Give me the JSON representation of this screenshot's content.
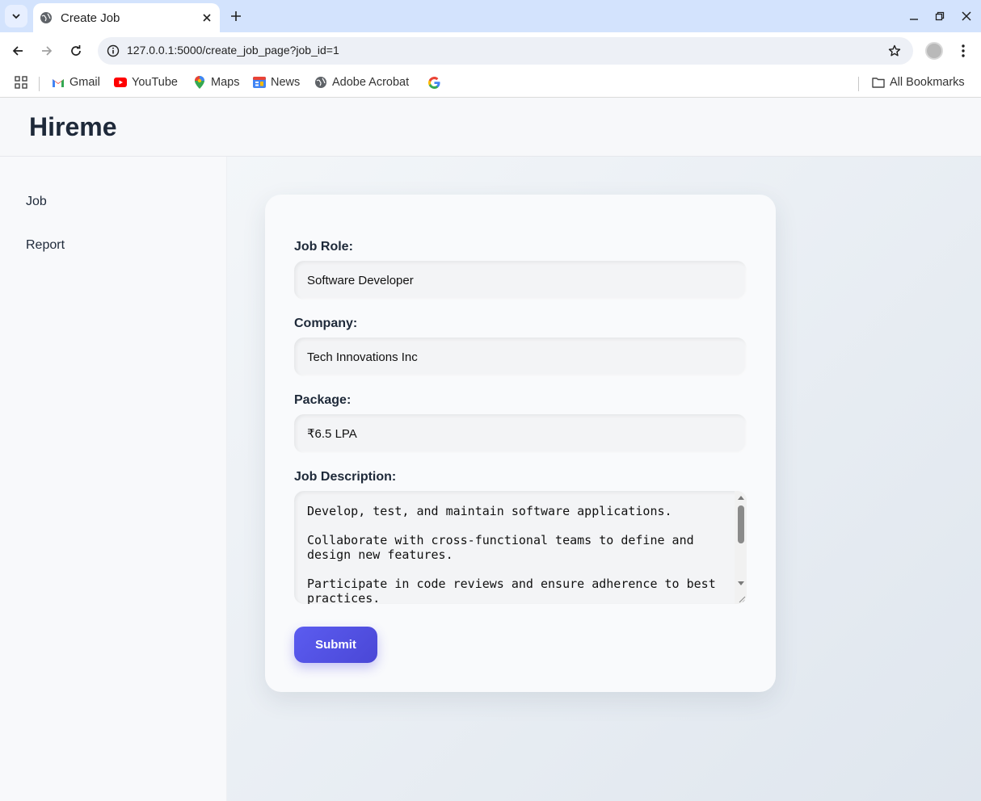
{
  "browser": {
    "tab_title": "Create Job",
    "url": "127.0.0.1:5000/create_job_page?job_id=1",
    "bookmarks": [
      {
        "label": "Gmail",
        "icon": "gmail-icon"
      },
      {
        "label": "YouTube",
        "icon": "youtube-icon"
      },
      {
        "label": "Maps",
        "icon": "maps-icon"
      },
      {
        "label": "News",
        "icon": "news-icon"
      },
      {
        "label": "Adobe Acrobat",
        "icon": "globe-icon"
      },
      {
        "label": "",
        "icon": "google-icon"
      }
    ],
    "all_bookmarks": "All Bookmarks"
  },
  "app": {
    "brand": "Hireme"
  },
  "sidebar": {
    "items": [
      {
        "label": "Job"
      },
      {
        "label": "Report"
      }
    ]
  },
  "form": {
    "job_role_label": "Job Role:",
    "job_role_value": "Software Developer",
    "company_label": "Company:",
    "company_value": "Tech Innovations Inc",
    "package_label": "Package:",
    "package_value": "₹6.5 LPA",
    "description_label": "Job Description:",
    "description_value": "Develop, test, and maintain software applications.\n\nCollaborate with cross-functional teams to define and design new features.\n\nParticipate in code reviews and ensure adherence to best practices.",
    "submit_label": "Submit"
  },
  "colors": {
    "accent": "#4f46e5",
    "heading": "#1e2939",
    "tabbar": "#d3e3fd"
  }
}
